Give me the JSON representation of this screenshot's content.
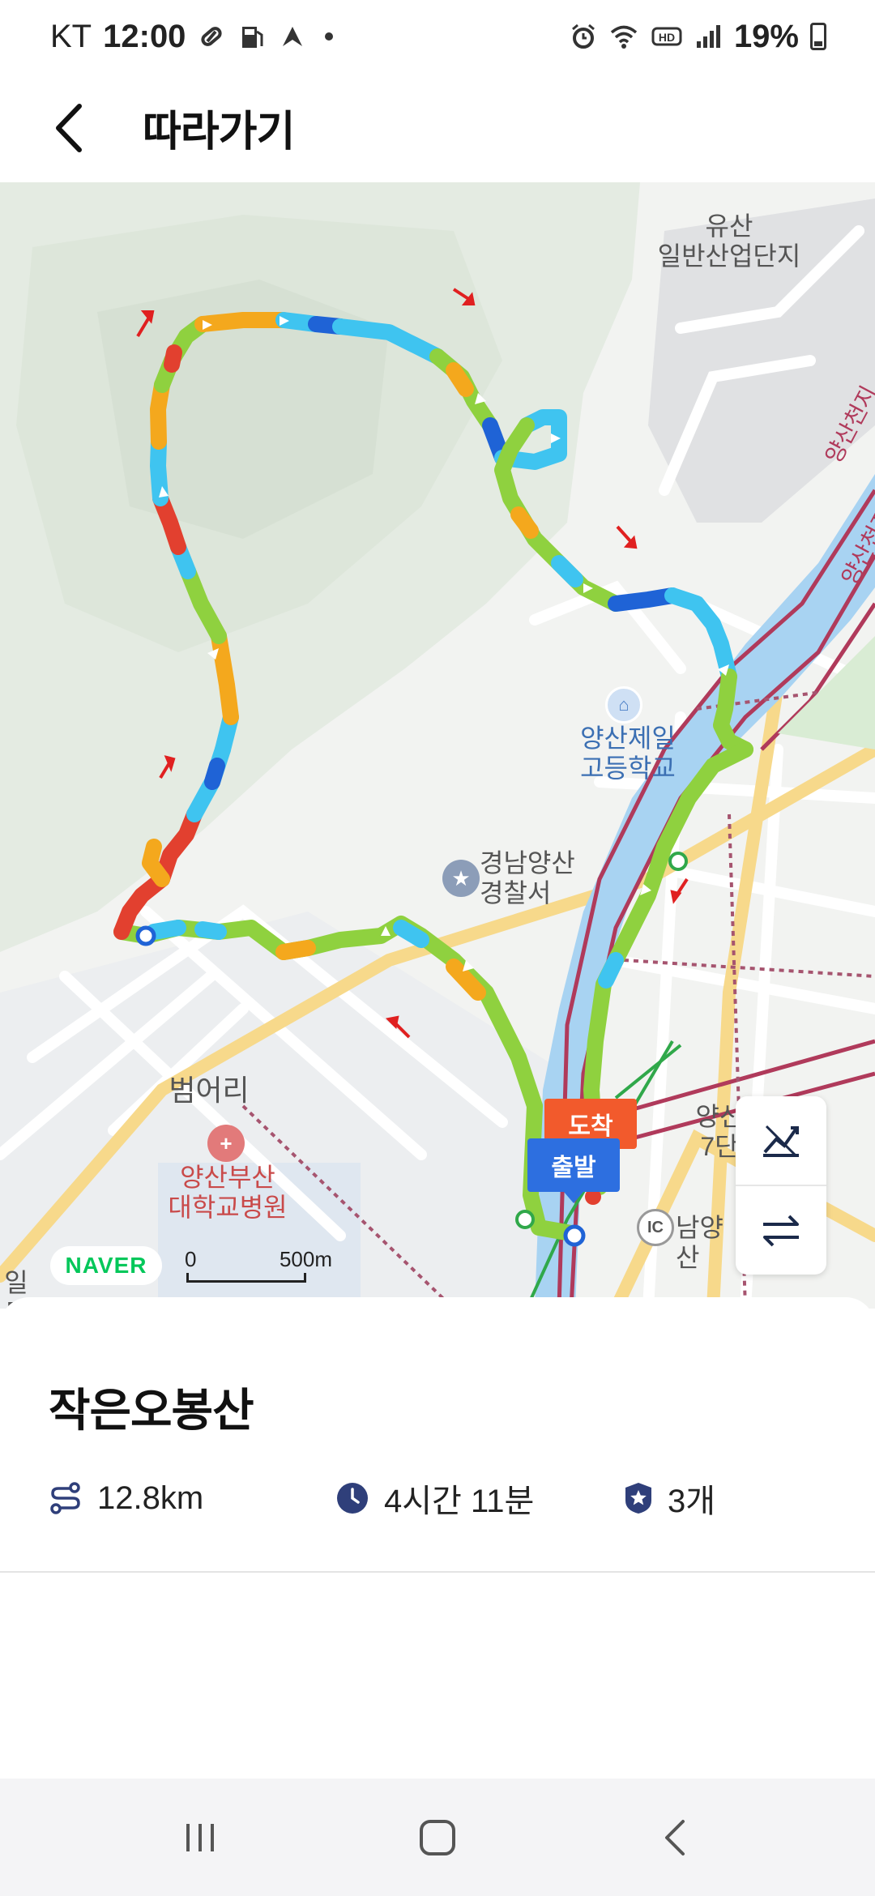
{
  "status_bar": {
    "carrier": "KT",
    "time": "12:00",
    "battery": "19%",
    "icons": [
      "pill-icon",
      "fuel-icon",
      "navigation-icon",
      "alarm-icon",
      "wifi-icon",
      "hd-icon",
      "signal-icon",
      "battery-icon"
    ]
  },
  "header": {
    "title": "따라가기"
  },
  "map": {
    "labels": {
      "industrial": "유산\n일반산업단지",
      "school": "양산제일\n고등학교",
      "police": "경남양산\n경찰서",
      "district": "범어리",
      "hospital": "양산부산\n대학교병원",
      "ic": "남양산",
      "partial_right": "양산\n7단",
      "partial_left": "일\n트",
      "river_road_1": "양산천지",
      "river_road_2": "양산천지"
    },
    "arrive_tag": "도착",
    "depart_tag": "출발",
    "ic_badge": "IC",
    "naver": "NAVER",
    "scale_zero": "0",
    "scale_distance": "500m",
    "colors": {
      "green": "#8fd13f",
      "orange": "#f4a81d",
      "red": "#e2402f",
      "sky": "#3fc4f0",
      "blue": "#1f63d6",
      "arrow_red": "#e02020"
    }
  },
  "course": {
    "name": "작은오봉산",
    "distance": "12.8km",
    "duration": "4시간 11분",
    "stamps": "3개"
  }
}
